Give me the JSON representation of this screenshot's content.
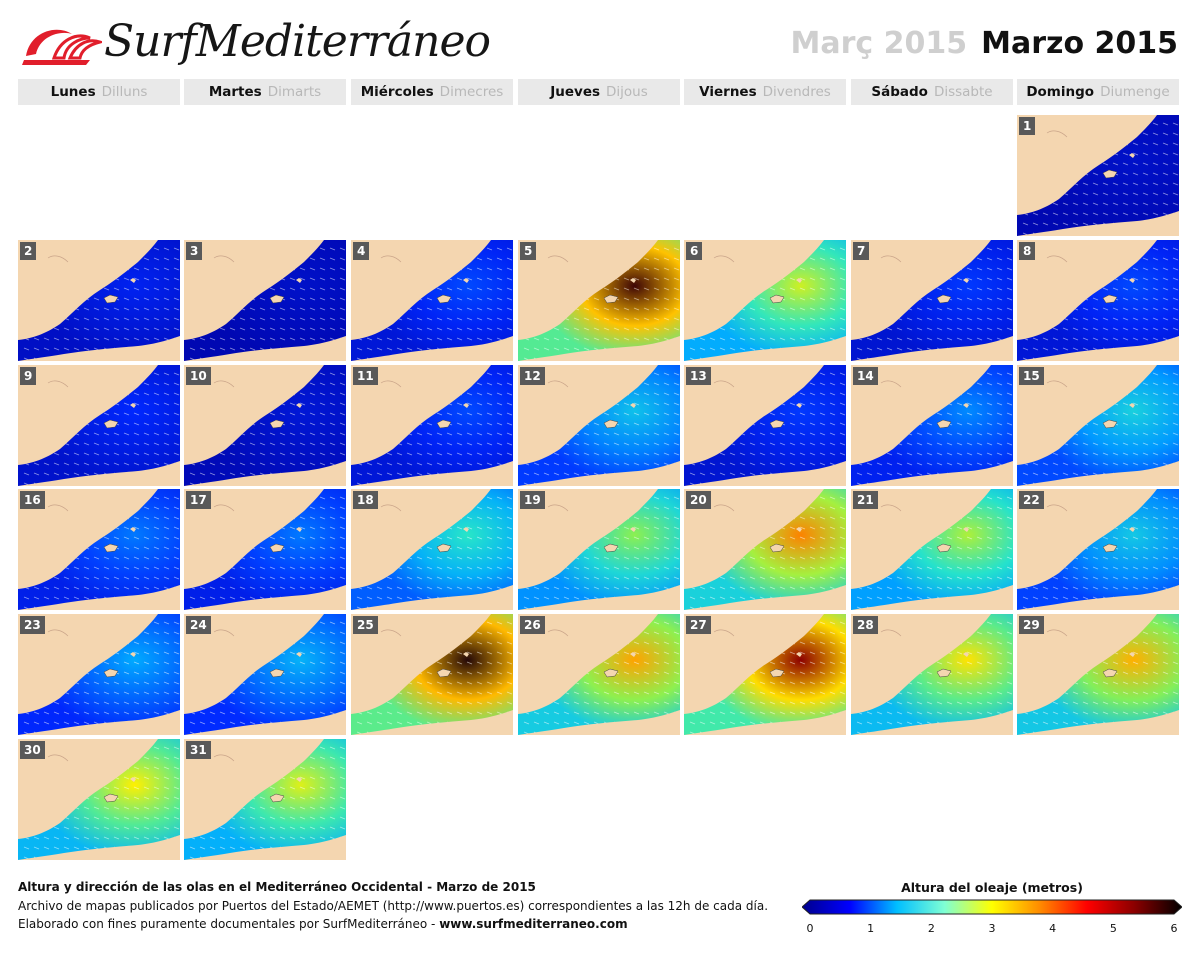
{
  "header": {
    "logo_text": "SurfMediterráneo",
    "month_ca": "Març 2015",
    "month_es": "Marzo 2015"
  },
  "weekdays": [
    {
      "es": "Lunes",
      "ca": "Dilluns"
    },
    {
      "es": "Martes",
      "ca": "Dimarts"
    },
    {
      "es": "Miércoles",
      "ca": "Dimecres"
    },
    {
      "es": "Jueves",
      "ca": "Dijous"
    },
    {
      "es": "Viernes",
      "ca": "Divendres"
    },
    {
      "es": "Sábado",
      "ca": "Dissabte"
    },
    {
      "es": "Domingo",
      "ca": "Diumenge"
    }
  ],
  "days": [
    {
      "n": "1",
      "wave_level": 0.3
    },
    {
      "n": "2",
      "wave_level": 0.6
    },
    {
      "n": "3",
      "wave_level": 0.3
    },
    {
      "n": "4",
      "wave_level": 0.9
    },
    {
      "n": "5",
      "wave_level": 5.8
    },
    {
      "n": "6",
      "wave_level": 3.4
    },
    {
      "n": "7",
      "wave_level": 0.8
    },
    {
      "n": "8",
      "wave_level": 0.9
    },
    {
      "n": "9",
      "wave_level": 0.7
    },
    {
      "n": "10",
      "wave_level": 0.4
    },
    {
      "n": "11",
      "wave_level": 0.9
    },
    {
      "n": "12",
      "wave_level": 1.8
    },
    {
      "n": "13",
      "wave_level": 0.8
    },
    {
      "n": "14",
      "wave_level": 1.3
    },
    {
      "n": "15",
      "wave_level": 2.0
    },
    {
      "n": "16",
      "wave_level": 1.2
    },
    {
      "n": "17",
      "wave_level": 1.2
    },
    {
      "n": "18",
      "wave_level": 2.3
    },
    {
      "n": "19",
      "wave_level": 3.0
    },
    {
      "n": "20",
      "wave_level": 4.5
    },
    {
      "n": "21",
      "wave_level": 3.2
    },
    {
      "n": "22",
      "wave_level": 1.9
    },
    {
      "n": "23",
      "wave_level": 1.5
    },
    {
      "n": "24",
      "wave_level": 1.6
    },
    {
      "n": "25",
      "wave_level": 5.9
    },
    {
      "n": "26",
      "wave_level": 4.3
    },
    {
      "n": "27",
      "wave_level": 5.5
    },
    {
      "n": "28",
      "wave_level": 3.8
    },
    {
      "n": "29",
      "wave_level": 4.2
    },
    {
      "n": "30",
      "wave_level": 3.7
    },
    {
      "n": "31",
      "wave_level": 3.5
    }
  ],
  "footer": {
    "title": "Altura y dirección de las olas en el Mediterráneo Occidental - Marzo de 2015",
    "line2": "Archivo de mapas publicados por Puertos del Estado/AEMET (http://www.puertos.es) correspondientes a las 12h de cada día.",
    "line3_prefix": "Elaborado con fines puramente documentales por SurfMediterráneo - ",
    "line3_url": "www.surfmediterraneo.com"
  },
  "legend": {
    "title": "Altura del oleaje (metros)",
    "ticks": [
      "0",
      "1",
      "2",
      "3",
      "4",
      "5",
      "6"
    ],
    "colors": [
      "#00008b",
      "#0000ff",
      "#00bfff",
      "#7fffd4",
      "#ffff00",
      "#ff8c00",
      "#ff0000",
      "#8b0000",
      "#000000"
    ]
  }
}
